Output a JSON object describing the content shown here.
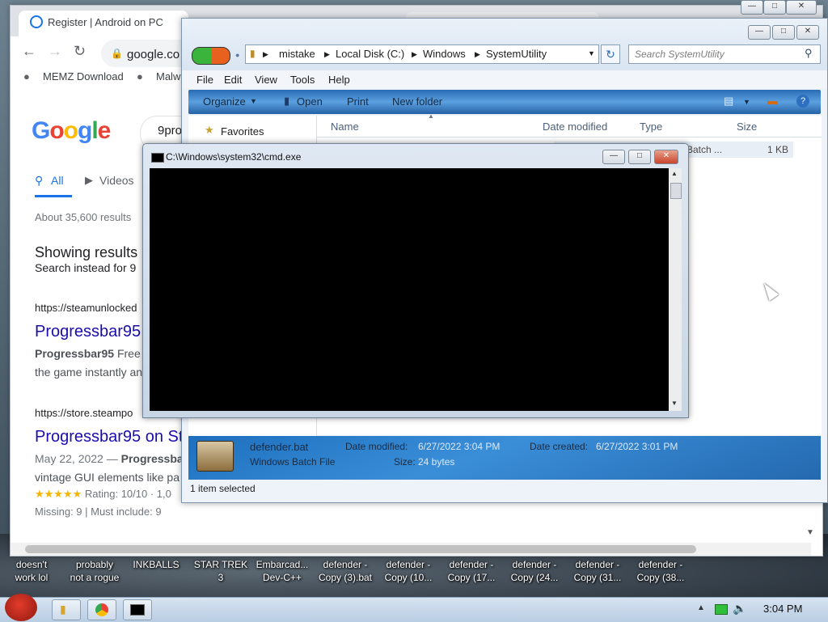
{
  "chrome": {
    "tab_title": "Register | Android on PC",
    "url": "google.co",
    "bookmarks": [
      "MEMZ Download",
      "Malw"
    ],
    "search_query": "9pro",
    "tabs": [
      "All",
      "Videos"
    ],
    "result_stats": "About 35,600 results",
    "showing_results": "Showing results",
    "search_instead": "Search instead for 9",
    "results": [
      {
        "url": "https://steamunlocked",
        "title": "Progressbar95",
        "snippet_bold": "Progressbar95",
        "snippet": " Free",
        "snippet2": "the game instantly an"
      },
      {
        "url": "https://store.steampo",
        "title": "Progressbar95 on St",
        "snippet": "May 22, 2022 — ",
        "snippet_bold": "Progressbar",
        "snippet2": "vintage GUI elements like pa"
      }
    ],
    "rating_stars": "★★★★★",
    "rating_text": " Rating: 10/10 · 1,0",
    "missing_text": "Missing: 9 | Must include: 9"
  },
  "explorer": {
    "breadcrumbs": [
      "mistake",
      "Local Disk (C:)",
      "Windows",
      "SystemUtility"
    ],
    "search_placeholder": "Search SystemUtility",
    "menu": [
      "File",
      "Edit",
      "View",
      "Tools",
      "Help"
    ],
    "commands": [
      "Organize",
      "Open",
      "Print",
      "New folder"
    ],
    "favorites": "Favorites",
    "columns": [
      "Name",
      "Date modified",
      "Type",
      "Size"
    ],
    "file_row": {
      "type": "Batch ...",
      "size": "1 KB"
    },
    "details": {
      "name": "defender.bat",
      "kind": "Windows Batch File",
      "date_modified_label": "Date modified:",
      "date_modified": "6/27/2022 3:04 PM",
      "date_created_label": "Date created:",
      "date_created": "6/27/2022 3:01 PM",
      "size_label": "Size:",
      "size": "24 bytes"
    },
    "status": "1 item selected"
  },
  "cmd": {
    "title": "C:\\Windows\\system32\\cmd.exe"
  },
  "desktop_icons": [
    {
      "line1": "doesn't",
      "line2": "work lol"
    },
    {
      "line1": "probably",
      "line2": "not a rogue"
    },
    {
      "line1": "INKBALLS",
      "line2": ""
    },
    {
      "line1": "STAR TREK",
      "line2": "3"
    },
    {
      "line1": "Embarcad...",
      "line2": "Dev-C++"
    },
    {
      "line1": "defender -",
      "line2": "Copy (3).bat"
    },
    {
      "line1": "defender -",
      "line2": "Copy (10..."
    },
    {
      "line1": "defender -",
      "line2": "Copy (17..."
    },
    {
      "line1": "defender -",
      "line2": "Copy (24..."
    },
    {
      "line1": "defender -",
      "line2": "Copy (31..."
    },
    {
      "line1": "defender -",
      "line2": "Copy (38..."
    }
  ],
  "taskbar": {
    "clock": "3:04 PM"
  },
  "icons": {
    "chrome_favicon": "android-icon",
    "lock": "lock-icon",
    "search": "magnifier-icon",
    "refresh": "refresh-icon"
  }
}
